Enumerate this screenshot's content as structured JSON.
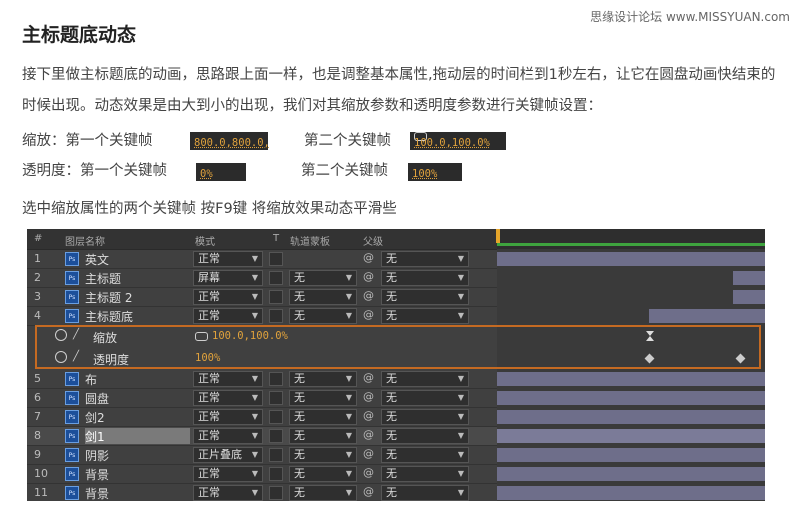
{
  "watermark": "思缘设计论坛 www.MISSYUAN.com",
  "title": "主标题底动态",
  "paragraph": "接下里做主标题底的动画，思路跟上面一样，也是调整基本属性,拖动层的时间栏到1秒左右，让它在圆盘动画快结束的时候出现。动态效果是由大到小的出现，我们对其缩放参数和透明度参数进行关键帧设置：",
  "keyframes": {
    "scale_label": "缩放：第一个关键帧",
    "scale_first": "800.0,800.0,",
    "scale_second_label": "第二个关键帧",
    "scale_second": "100.0,100.0%",
    "opacity_label": "透明度：第一个关键帧",
    "opacity_first": "0%",
    "opacity_second_label": "第二个关键帧",
    "opacity_second": "100%"
  },
  "note": "选中缩放属性的两个关键帧 按F9键 将缩放效果动态平滑些",
  "panel": {
    "headers": [
      "#",
      "图层名称",
      "模式",
      "T",
      "轨道蒙板",
      "父级"
    ],
    "layers": [
      {
        "num": "1",
        "name": "英文",
        "mode": "正常",
        "track": "",
        "parent": "无"
      },
      {
        "num": "2",
        "name": "主标题",
        "mode": "屏幕",
        "track": "无",
        "parent": "无"
      },
      {
        "num": "3",
        "name": "主标题 2",
        "mode": "正常",
        "track": "无",
        "parent": "无"
      },
      {
        "num": "4",
        "name": "主标题底",
        "mode": "正常",
        "track": "无",
        "parent": "无"
      },
      {
        "num": "5",
        "name": "布",
        "mode": "正常",
        "track": "无",
        "parent": "无"
      },
      {
        "num": "6",
        "name": "圆盘",
        "mode": "正常",
        "track": "无",
        "parent": "无"
      },
      {
        "num": "7",
        "name": "剑2",
        "mode": "正常",
        "track": "无",
        "parent": "无"
      },
      {
        "num": "8",
        "name": "剑1",
        "mode": "正常",
        "track": "无",
        "parent": "无"
      },
      {
        "num": "9",
        "name": "阴影",
        "mode": "正片叠底",
        "track": "无",
        "parent": "无"
      },
      {
        "num": "10",
        "name": "背景",
        "mode": "正常",
        "track": "无",
        "parent": "无"
      },
      {
        "num": "11",
        "name": "背景",
        "mode": "正常",
        "track": "无",
        "parent": "无"
      }
    ],
    "props": [
      {
        "name": "缩放",
        "value": "100.0,100.0%"
      },
      {
        "name": "透明度",
        "value": "100%"
      }
    ],
    "ps_badge": "Ps",
    "colors": {
      "accent": "#e0a23c",
      "highlight_border": "#c56a22",
      "timeline_green": "#3ea33e"
    }
  }
}
